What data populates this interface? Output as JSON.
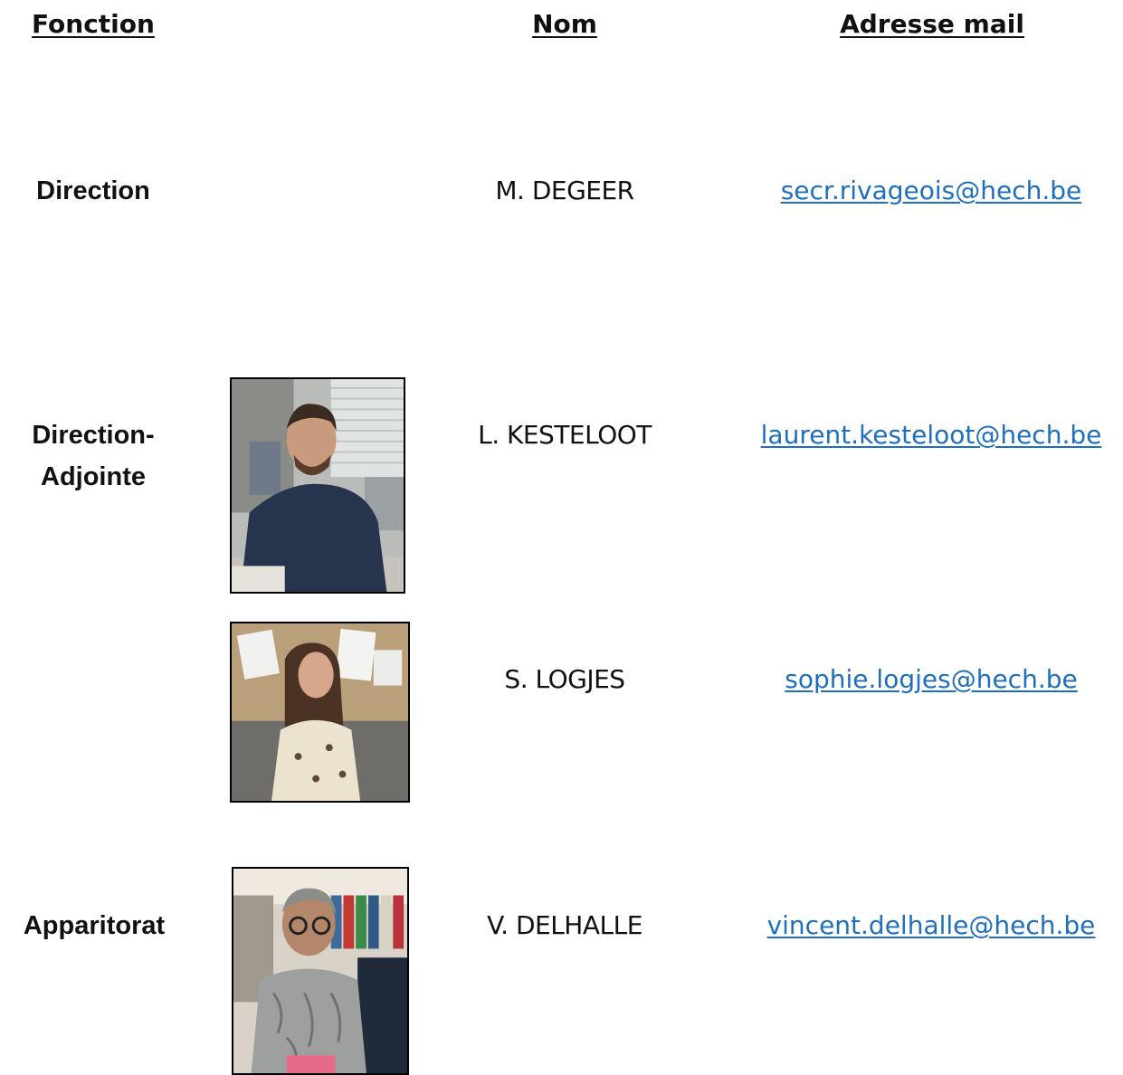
{
  "headers": {
    "fonction": "Fonction",
    "nom": "Nom",
    "adresse": "Adresse mail"
  },
  "rows": [
    {
      "fonction": "Direction",
      "nom": "M. DEGEER",
      "mail": "secr.rivageois@hech.be"
    },
    {
      "fonction_line1": "Direction-",
      "fonction_line2": "Adjointe",
      "nom": "L. KESTELOOT",
      "mail": "laurent.kesteloot@hech.be"
    },
    {
      "nom": "S. LOGJES",
      "mail": "sophie.logjes@hech.be"
    },
    {
      "fonction": "Apparitorat",
      "nom": "V. DELHALLE",
      "mail": "vincent.delhalle@hech.be"
    }
  ],
  "colors": {
    "link": "#1f6fbf",
    "text": "#111111"
  }
}
